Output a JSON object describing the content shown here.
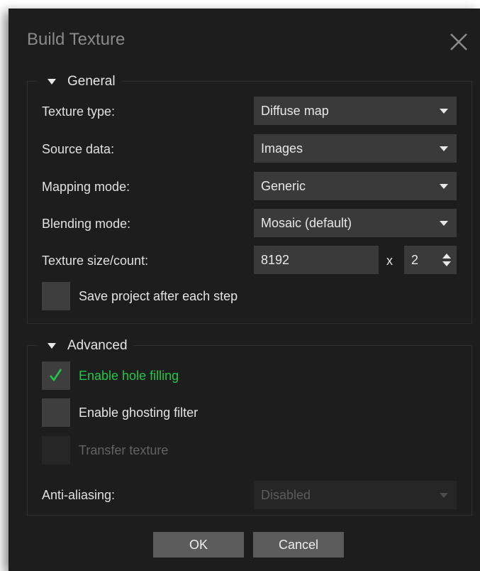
{
  "dialog": {
    "title": "Build Texture",
    "close_icon": "close-icon"
  },
  "general": {
    "header": "General",
    "texture_type": {
      "label": "Texture type:",
      "value": "Diffuse map"
    },
    "source_data": {
      "label": "Source data:",
      "value": "Images"
    },
    "mapping_mode": {
      "label": "Mapping mode:",
      "value": "Generic"
    },
    "blending_mode": {
      "label": "Blending mode:",
      "value": "Mosaic (default)"
    },
    "texture_size": {
      "label": "Texture size/count:",
      "size": "8192",
      "separator": "x",
      "count": "2"
    },
    "save_project": {
      "label": "Save project after each step",
      "checked": false
    }
  },
  "advanced": {
    "header": "Advanced",
    "hole_filling": {
      "label": "Enable hole filling",
      "checked": true
    },
    "ghosting_filter": {
      "label": "Enable ghosting filter",
      "checked": false
    },
    "transfer_texture": {
      "label": "Transfer texture",
      "checked": false,
      "enabled": false
    },
    "anti_aliasing": {
      "label": "Anti-aliasing:",
      "value": "Disabled",
      "enabled": false
    }
  },
  "buttons": {
    "ok": "OK",
    "cancel": "Cancel"
  },
  "colors": {
    "background": "#1d1d1d",
    "control": "#3a3a3a",
    "checked_text": "#22c64a",
    "button": "#5c5c5c"
  }
}
